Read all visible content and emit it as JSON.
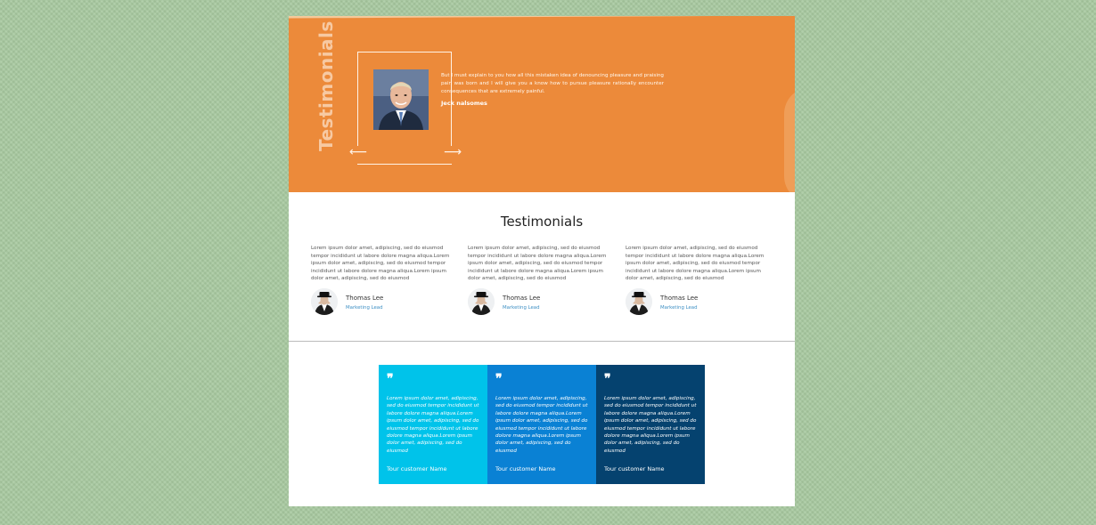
{
  "hero": {
    "vertical_title": "Testimonials",
    "quote": "But I must explain to you how all this mistaken idea of denouncing pleasure and praising pain was born and I will give you a know how to pursue pleasure rationally encounter consequences that are extremely painful.",
    "author": "Jeck nalsomes",
    "prev_arrow": "⟵",
    "next_arrow": "⟶"
  },
  "testimonials": {
    "title": "Testimonials",
    "cards": [
      {
        "text": "Lorem ipsum dolor amet, adipiscing, sed do eiusmod tempor incididunt ut labore dolore magna aliqua.Lorem ipsum dolor amet, adipiscing, sed do eiusmod tempor incididunt ut labore dolore magna aliqua.Lorem ipsum dolor amet, adipiscing, sed do eiusmod",
        "name": "Thomas Lee",
        "role": "Marketing Lead"
      },
      {
        "text": "Lorem ipsum dolor amet, adipiscing, sed do eiusmod tempor incididunt ut labore dolore magna aliqua.Lorem ipsum dolor amet, adipiscing, sed do eiusmod tempor incididunt ut labore dolore magna aliqua.Lorem ipsum dolor amet, adipiscing, sed do eiusmod",
        "name": "Thomas Lee",
        "role": "Marketing Lead"
      },
      {
        "text": "Lorem ipsum dolor amet, adipiscing, sed do eiusmod tempor incididunt ut labore dolore magna aliqua.Lorem ipsum dolor amet, adipiscing, sed do eiusmod tempor incididunt ut labore dolore magna aliqua.Lorem ipsum dolor amet, adipiscing, sed do eiusmod",
        "name": "Thomas Lee",
        "role": "Marketing Lead"
      }
    ]
  },
  "quote_panels": [
    {
      "quote_mark": "❞",
      "text": "Lorem ipsum dolor amet, adipiscing, sed do eiusmod tempor incididunt ut labore dolore magna aliqua.Lorem ipsum dolor amet, adipiscing, sed do eiusmod tempor incididunt ut labore dolore magna aliqua.Lorem ipsum dolor amet, adipiscing, sed do eiusmod",
      "name": "Tour customer Name",
      "color": "#00c3ea"
    },
    {
      "quote_mark": "❞",
      "text": "Lorem ipsum dolor amet, adipiscing, sed do eiusmod tempor incididunt ut labore dolore magna aliqua.Lorem ipsum dolor amet, adipiscing, sed do eiusmod tempor incididunt ut labore dolore magna aliqua.Lorem ipsum dolor amet, adipiscing, sed do eiusmod",
      "name": "Tour customer Name",
      "color": "#0a81d4"
    },
    {
      "quote_mark": "❞",
      "text": "Lorem ipsum dolor amet, adipiscing, sed do eiusmod tempor incididunt ut labore dolore magna aliqua.Lorem ipsum dolor amet, adipiscing, sed do eiusmod tempor incididunt ut labore dolore magna aliqua.Lorem ipsum dolor amet, adipiscing, sed do eiusmod",
      "name": "Tour customer Name",
      "color": "#05426f"
    }
  ],
  "colors": {
    "hero_orange": "#ec8a3a",
    "link_blue": "#3d8fc4"
  }
}
